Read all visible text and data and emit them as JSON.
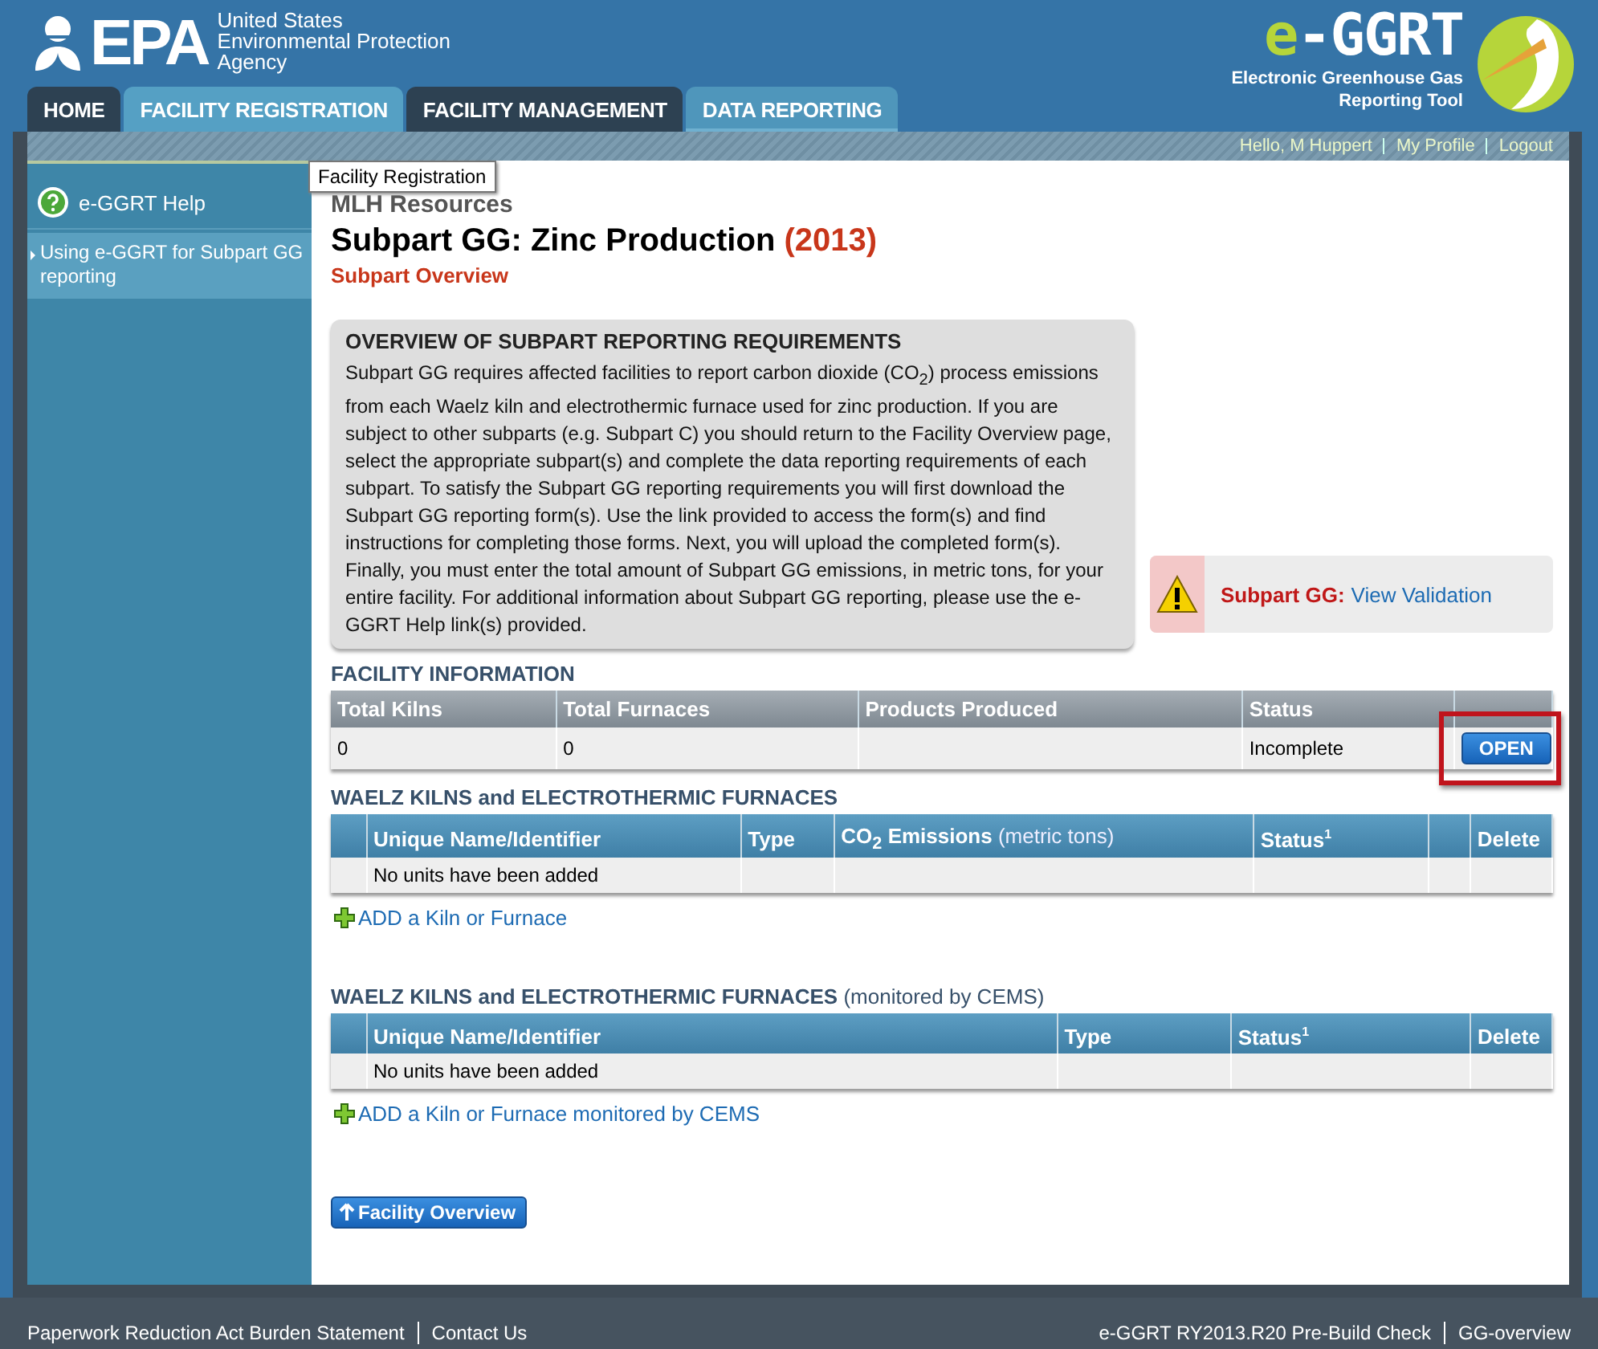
{
  "header": {
    "agency_logo": "EPA",
    "agency_name": [
      "United States",
      "Environmental Protection",
      "Agency"
    ],
    "app_logo": {
      "prefix": "e",
      "name": "-GGRT",
      "tagline": "Electronic Greenhouse Gas Reporting Tool"
    }
  },
  "tabs": [
    {
      "label": "HOME",
      "selected": false,
      "hovered": false
    },
    {
      "label": "FACILITY REGISTRATION",
      "selected": false,
      "hovered": true
    },
    {
      "label": "FACILITY MANAGEMENT",
      "selected": false,
      "hovered": false
    },
    {
      "label": "DATA REPORTING",
      "selected": true,
      "hovered": false
    }
  ],
  "tooltip": "Facility Registration",
  "user_links": [
    "Hello, M Huppert",
    "My Profile",
    "Logout"
  ],
  "sidebar": {
    "items": [
      {
        "kind": "help",
        "label": "e-GGRT Help"
      },
      {
        "kind": "link",
        "label": "Using e-GGRT for Subpart GG reporting"
      }
    ]
  },
  "content": {
    "facility": "MLH Resources",
    "title": "Subpart GG: Zinc Production",
    "year": "(2013)",
    "subtitle": "Subpart Overview",
    "overview": {
      "heading": "OVERVIEW OF SUBPART REPORTING REQUIREMENTS",
      "text": "Subpart GG requires affected facilities to report carbon dioxide (CO$_{2}$) process emissions from each Waelz kiln and electrothermic furnace used for zinc production. If you are subject to other subparts (e.g. Subpart C) you should return to the Facility Overview page, select the appropriate subpart(s) and complete the data reporting requirements of each subpart. To satisfy the Subpart GG reporting requirements you will first download the Subpart GG reporting form(s). Use the link provided to access the form(s) and find instructions for completing those forms. Next, you will upload the completed form(s). Finally, you must enter the total amount of Subpart GG emissions, in metric tons, for your entire facility. For additional information about Subpart GG reporting, please use the e-GGRT Help link(s) provided."
    },
    "validation": {
      "label": "Subpart GG:",
      "link": "View Validation"
    },
    "tables": [
      {
        "title": "FACILITY INFORMATION",
        "kind": "summary",
        "columns": [
          {
            "label": "Total Kilns"
          },
          {
            "label": "Total Furnaces"
          },
          {
            "label": "Products Produced"
          },
          {
            "label": "Status"
          },
          {}
        ],
        "rows": [
          {
            "cells": [
              "0",
              "0",
              null,
              "Incomplete",
              null
            ],
            "button": {
              "label": "OPEN",
              "highlighted": true
            }
          }
        ]
      },
      {
        "title": "WAELZ KILNS and ELECTROTHERMIC FURNACES",
        "kind": "units",
        "columns": [
          {},
          {
            "label": "Unique Name/Identifier"
          },
          {
            "label": "Type"
          },
          {
            "label": "CO$_{2}$ Emissions",
            "note": "(metric tons)"
          },
          {
            "label": "Status$^{1}$"
          },
          {},
          {
            "label": "Delete"
          }
        ],
        "rows": [
          {
            "cells": [
              null,
              "No units have been added",
              null,
              null,
              null,
              null,
              null
            ]
          }
        ],
        "add_link": "ADD a Kiln or Furnace"
      },
      {
        "title": "WAELZ KILNS and ELECTROTHERMIC FURNACES",
        "title_note": "(monitored by CEMS)",
        "kind": "units",
        "columns": [
          {},
          {
            "label": "Unique Name/Identifier"
          },
          {
            "label": "Type"
          },
          {
            "label": "Status$^{1}$"
          },
          {
            "label": "Delete"
          }
        ],
        "rows": [
          {
            "cells": [
              null,
              "No units have been added",
              null,
              null,
              null
            ]
          }
        ],
        "add_link": "ADD a Kiln or Furnace monitored by CEMS"
      }
    ],
    "back_button": "Facility Overview"
  },
  "footer": {
    "left": [
      "Paperwork Reduction Act Burden Statement",
      "Contact Us"
    ],
    "right": [
      "e-GGRT RY2013.R20 Pre-Build Check",
      "GG-overview"
    ]
  }
}
